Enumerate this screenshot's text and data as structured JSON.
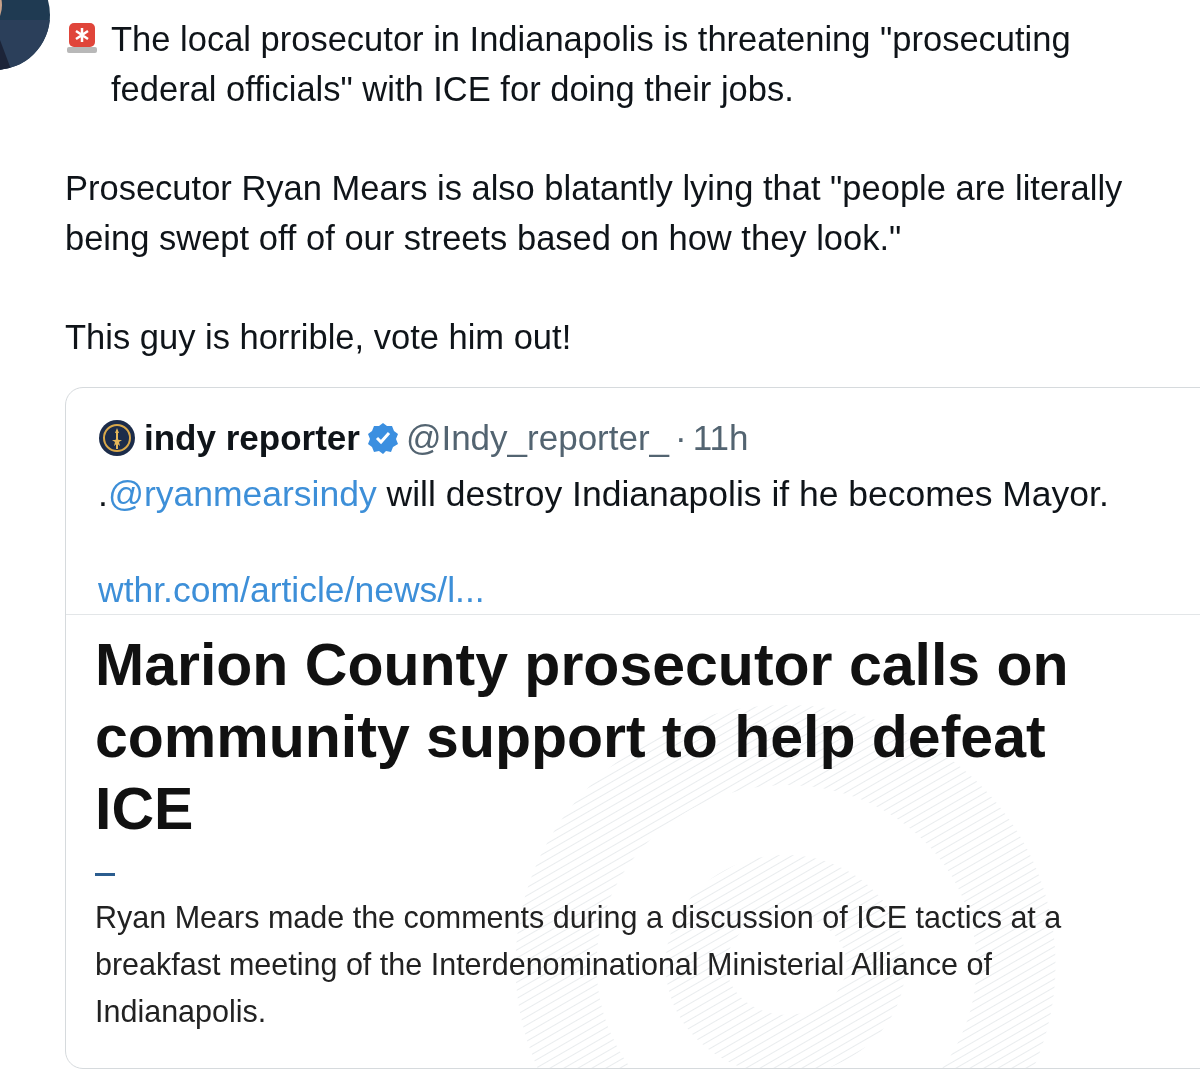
{
  "post": {
    "paragraphs": [
      {
        "kind": "alert",
        "text": "The local prosecutor in Indianapolis is threatening \"prosecuting federal officials\" with ICE for doing their jobs."
      },
      {
        "kind": "plain",
        "text": "Prosecutor Ryan Mears is also blatantly lying that \"people are literally being swept off of our streets based on how they look.\""
      },
      {
        "kind": "plain",
        "text": "This guy is horrible, vote him out!"
      }
    ]
  },
  "quote": {
    "author": {
      "name": "indy reporter",
      "verified": true,
      "handle": "@Indy_reporter_",
      "separator": "·",
      "time": "11h"
    },
    "text_parts": [
      {
        "kind": "plain",
        "text": "."
      },
      {
        "kind": "mention",
        "text": "@ryanmearsindy"
      },
      {
        "kind": "plain",
        "text": " will destroy Indianapolis if he becomes Mayor."
      }
    ],
    "link": "wthr.com/article/news/l...",
    "article": {
      "title": "Marion County prosecutor calls on community support to help defeat ICE",
      "summary": "Ryan Mears made the comments during a discussion of ICE tactics at a breakfast meeting of the Interdenominational Ministerial Alliance of Indianapolis."
    }
  }
}
